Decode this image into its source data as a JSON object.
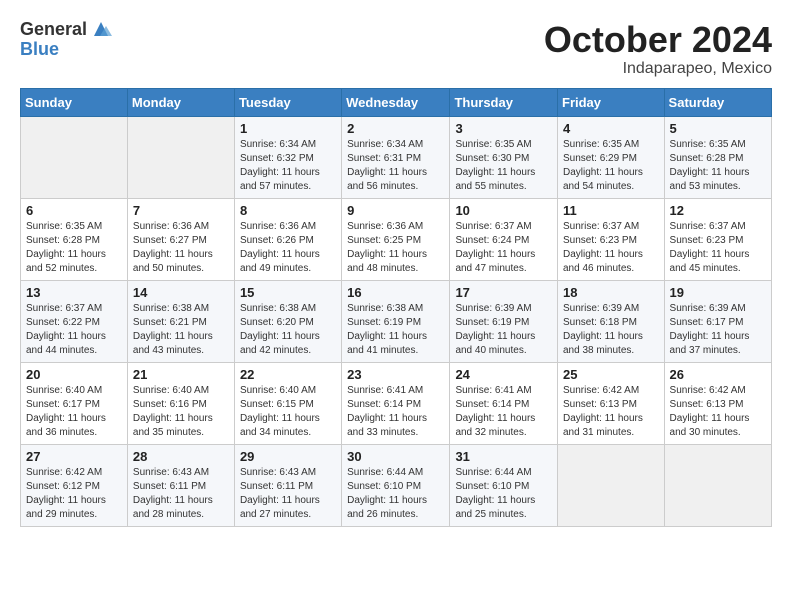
{
  "logo": {
    "general": "General",
    "blue": "Blue"
  },
  "title": "October 2024",
  "location": "Indaparapeo, Mexico",
  "days_of_week": [
    "Sunday",
    "Monday",
    "Tuesday",
    "Wednesday",
    "Thursday",
    "Friday",
    "Saturday"
  ],
  "weeks": [
    [
      {
        "day": "",
        "info": ""
      },
      {
        "day": "",
        "info": ""
      },
      {
        "day": "1",
        "sunrise": "6:34 AM",
        "sunset": "6:32 PM",
        "daylight": "11 hours and 57 minutes."
      },
      {
        "day": "2",
        "sunrise": "6:34 AM",
        "sunset": "6:31 PM",
        "daylight": "11 hours and 56 minutes."
      },
      {
        "day": "3",
        "sunrise": "6:35 AM",
        "sunset": "6:30 PM",
        "daylight": "11 hours and 55 minutes."
      },
      {
        "day": "4",
        "sunrise": "6:35 AM",
        "sunset": "6:29 PM",
        "daylight": "11 hours and 54 minutes."
      },
      {
        "day": "5",
        "sunrise": "6:35 AM",
        "sunset": "6:28 PM",
        "daylight": "11 hours and 53 minutes."
      }
    ],
    [
      {
        "day": "6",
        "sunrise": "6:35 AM",
        "sunset": "6:28 PM",
        "daylight": "11 hours and 52 minutes."
      },
      {
        "day": "7",
        "sunrise": "6:36 AM",
        "sunset": "6:27 PM",
        "daylight": "11 hours and 50 minutes."
      },
      {
        "day": "8",
        "sunrise": "6:36 AM",
        "sunset": "6:26 PM",
        "daylight": "11 hours and 49 minutes."
      },
      {
        "day": "9",
        "sunrise": "6:36 AM",
        "sunset": "6:25 PM",
        "daylight": "11 hours and 48 minutes."
      },
      {
        "day": "10",
        "sunrise": "6:37 AM",
        "sunset": "6:24 PM",
        "daylight": "11 hours and 47 minutes."
      },
      {
        "day": "11",
        "sunrise": "6:37 AM",
        "sunset": "6:23 PM",
        "daylight": "11 hours and 46 minutes."
      },
      {
        "day": "12",
        "sunrise": "6:37 AM",
        "sunset": "6:23 PM",
        "daylight": "11 hours and 45 minutes."
      }
    ],
    [
      {
        "day": "13",
        "sunrise": "6:37 AM",
        "sunset": "6:22 PM",
        "daylight": "11 hours and 44 minutes."
      },
      {
        "day": "14",
        "sunrise": "6:38 AM",
        "sunset": "6:21 PM",
        "daylight": "11 hours and 43 minutes."
      },
      {
        "day": "15",
        "sunrise": "6:38 AM",
        "sunset": "6:20 PM",
        "daylight": "11 hours and 42 minutes."
      },
      {
        "day": "16",
        "sunrise": "6:38 AM",
        "sunset": "6:19 PM",
        "daylight": "11 hours and 41 minutes."
      },
      {
        "day": "17",
        "sunrise": "6:39 AM",
        "sunset": "6:19 PM",
        "daylight": "11 hours and 40 minutes."
      },
      {
        "day": "18",
        "sunrise": "6:39 AM",
        "sunset": "6:18 PM",
        "daylight": "11 hours and 38 minutes."
      },
      {
        "day": "19",
        "sunrise": "6:39 AM",
        "sunset": "6:17 PM",
        "daylight": "11 hours and 37 minutes."
      }
    ],
    [
      {
        "day": "20",
        "sunrise": "6:40 AM",
        "sunset": "6:17 PM",
        "daylight": "11 hours and 36 minutes."
      },
      {
        "day": "21",
        "sunrise": "6:40 AM",
        "sunset": "6:16 PM",
        "daylight": "11 hours and 35 minutes."
      },
      {
        "day": "22",
        "sunrise": "6:40 AM",
        "sunset": "6:15 PM",
        "daylight": "11 hours and 34 minutes."
      },
      {
        "day": "23",
        "sunrise": "6:41 AM",
        "sunset": "6:14 PM",
        "daylight": "11 hours and 33 minutes."
      },
      {
        "day": "24",
        "sunrise": "6:41 AM",
        "sunset": "6:14 PM",
        "daylight": "11 hours and 32 minutes."
      },
      {
        "day": "25",
        "sunrise": "6:42 AM",
        "sunset": "6:13 PM",
        "daylight": "11 hours and 31 minutes."
      },
      {
        "day": "26",
        "sunrise": "6:42 AM",
        "sunset": "6:13 PM",
        "daylight": "11 hours and 30 minutes."
      }
    ],
    [
      {
        "day": "27",
        "sunrise": "6:42 AM",
        "sunset": "6:12 PM",
        "daylight": "11 hours and 29 minutes."
      },
      {
        "day": "28",
        "sunrise": "6:43 AM",
        "sunset": "6:11 PM",
        "daylight": "11 hours and 28 minutes."
      },
      {
        "day": "29",
        "sunrise": "6:43 AM",
        "sunset": "6:11 PM",
        "daylight": "11 hours and 27 minutes."
      },
      {
        "day": "30",
        "sunrise": "6:44 AM",
        "sunset": "6:10 PM",
        "daylight": "11 hours and 26 minutes."
      },
      {
        "day": "31",
        "sunrise": "6:44 AM",
        "sunset": "6:10 PM",
        "daylight": "11 hours and 25 minutes."
      },
      {
        "day": "",
        "info": ""
      },
      {
        "day": "",
        "info": ""
      }
    ]
  ]
}
